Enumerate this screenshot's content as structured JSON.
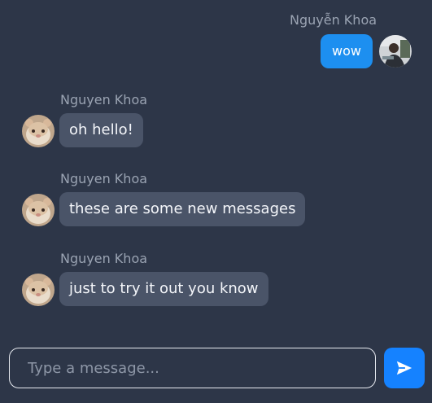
{
  "messages": [
    {
      "sender": "Nguyễn Khoa",
      "text": "wow",
      "from_self": true,
      "avatar": "user-photo-avatar"
    },
    {
      "sender": "Nguyen Khoa",
      "text": "oh hello!",
      "from_self": false,
      "avatar": "hamster-avatar"
    },
    {
      "sender": "Nguyen Khoa",
      "text": "these are some new messages",
      "from_self": false,
      "avatar": "hamster-avatar"
    },
    {
      "sender": "Nguyen Khoa",
      "text": "just to try it out you know",
      "from_self": false,
      "avatar": "hamster-avatar"
    }
  ],
  "composer": {
    "placeholder": "Type a message...",
    "value": ""
  },
  "send_button": {
    "icon": "send-arrow-icon",
    "color": "#1582ff"
  },
  "colors": {
    "background": "#2d3648",
    "incoming_bubble": "#4a5468",
    "outgoing_bubble": "#1d8ff0"
  }
}
